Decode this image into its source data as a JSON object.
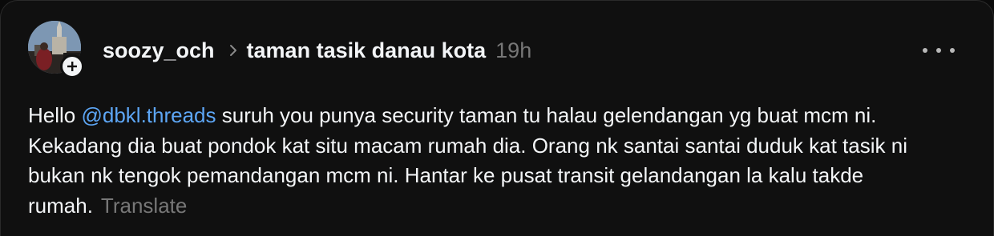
{
  "post": {
    "username": "soozy_och",
    "community": "taman tasik danau kota",
    "timestamp": "19h",
    "body": {
      "greeting": "Hello ",
      "mention": "@dbkl.threads",
      "text": " suruh you punya security taman tu halau gelendangan yg buat mcm ni. Kekadang dia buat pondok kat situ macam rumah dia. Orang nk santai santai duduk kat tasik ni bukan nk tengok pemandangan mcm ni. Hantar ke pusat transit gelandangan la kalu takde rumah.",
      "translate_label": "Translate"
    },
    "icons": {
      "follow": "plus-icon",
      "separator": "chevron-right-icon",
      "more": "more-horizontal-icon"
    },
    "colors": {
      "background": "#101010",
      "text": "#f3f5f7",
      "muted": "#777777",
      "mention": "#5da6f5"
    }
  }
}
